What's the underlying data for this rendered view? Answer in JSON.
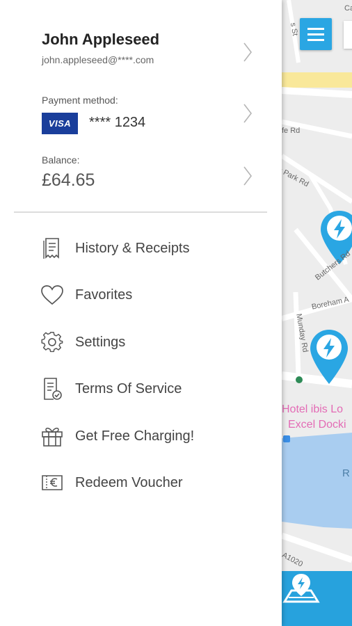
{
  "profile": {
    "name": "John Appleseed",
    "email": "john.appleseed@****.com"
  },
  "payment": {
    "label": "Payment method:",
    "card_brand": "VISA",
    "card_number": "**** 1234"
  },
  "balance": {
    "label": "Balance:",
    "amount": "£64.65"
  },
  "menu": {
    "items": [
      {
        "label": "History & Receipts",
        "icon": "receipt-icon"
      },
      {
        "label": "Favorites",
        "icon": "heart-icon"
      },
      {
        "label": "Settings",
        "icon": "gear-icon"
      },
      {
        "label": "Terms Of Service",
        "icon": "document-check-icon"
      },
      {
        "label": "Get Free Charging!",
        "icon": "gift-icon"
      },
      {
        "label": "Redeem Voucher",
        "icon": "voucher-euro-icon"
      }
    ]
  },
  "map": {
    "labels": {
      "road_a": "fe Rd",
      "road_b": "s Park Rd",
      "road_c": "Butchers Rd",
      "road_d": "Boreham A",
      "road_e": "Munday Rd",
      "road_f": "A1020",
      "road_g": "Ca",
      "road_h": "s St"
    },
    "hotel_line1": "Hotel ibis Lo",
    "hotel_line2": "Excel Docki",
    "water_label": "R"
  },
  "colors": {
    "accent": "#2aa6e3",
    "visa": "#1a3e9b",
    "hotel": "#e36bb5",
    "water": "#a9cdf0"
  }
}
